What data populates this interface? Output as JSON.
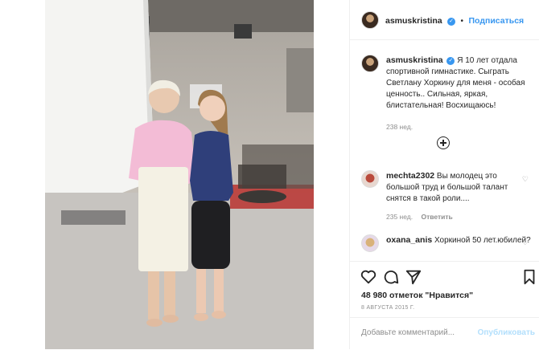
{
  "post": {
    "username": "asmuskristina",
    "follow_label": "Подписаться",
    "dot": "•",
    "caption": "Я 10 лет отдала спортивной гимнастике. Сыграть Светлану Хоркину для меня - особая ценность.. Сильная, яркая, блистательная! Восхищаюсь!",
    "caption_age": "238 нед.",
    "likes": "48 980 отметок \"Нравится\"",
    "date": "8 АВГУСТА 2015 Г.",
    "add_comment_placeholder": "Добавьте комментарий...",
    "publish_label": "Опубликовать"
  },
  "comments": [
    {
      "username": "mechta2302",
      "text": "Вы молодец это большой труд и большой талант снятся в такой роли....",
      "age": "235 нед.",
      "reply_label": "Ответить"
    },
    {
      "username": "oxana_anis",
      "text": "Хоркиной 50 лет.юбилей?"
    }
  ],
  "icons": [
    "verified-icon",
    "add-comments-icon",
    "heart-icon",
    "comment-icon",
    "share-icon",
    "bookmark-icon",
    "comment-like-icon"
  ],
  "colors": {
    "link": "#3897f0",
    "muted": "#8e8e8e",
    "text": "#262626",
    "publish_disabled": "#b2dffc"
  }
}
